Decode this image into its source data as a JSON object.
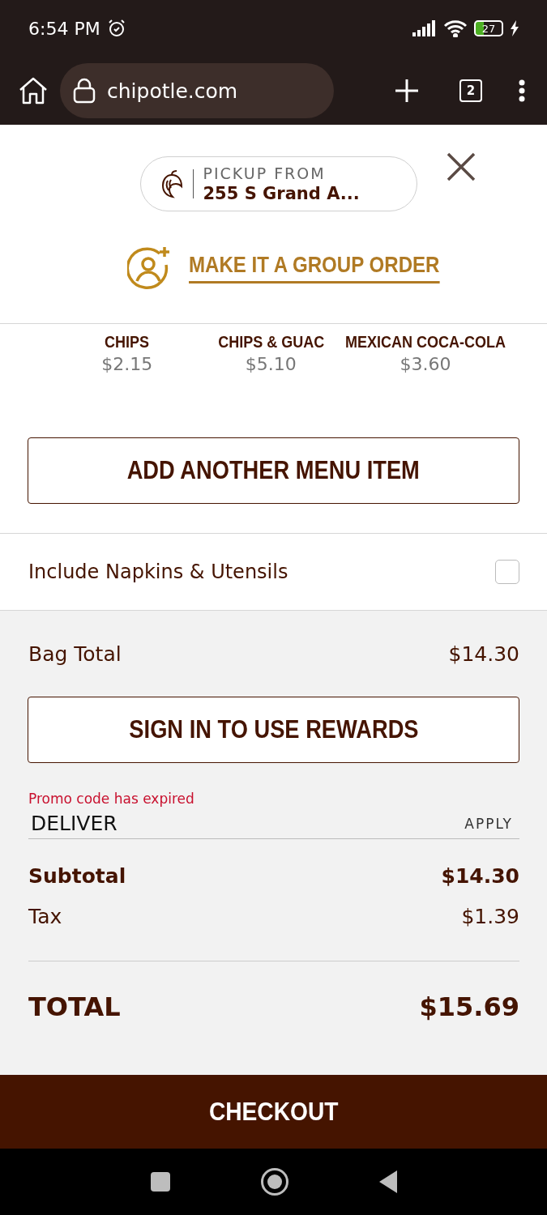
{
  "status_bar": {
    "time": "6:54 PM",
    "battery": "27"
  },
  "browser": {
    "url": "chipotle.com",
    "tab_count": "2"
  },
  "pickup": {
    "label": "PICKUP FROM",
    "address": "255 S Grand A..."
  },
  "group_order": "MAKE IT A GROUP ORDER",
  "suggestions": [
    {
      "name": "CHIPS",
      "price": "$2.15"
    },
    {
      "name": "CHIPS & GUAC",
      "price": "$5.10"
    },
    {
      "name": "MEXICAN COCA-COLA",
      "price": "$3.60"
    }
  ],
  "add_item_button": "ADD ANOTHER MENU ITEM",
  "napkins": {
    "label": "Include Napkins & Utensils",
    "checked": false
  },
  "bag_total": {
    "label": "Bag Total",
    "value": "$14.30"
  },
  "rewards_button": "SIGN IN TO USE REWARDS",
  "promo": {
    "error": "Promo code has expired",
    "value": "DELIVER",
    "apply": "APPLY"
  },
  "summary": [
    {
      "label": "Subtotal",
      "value": "$14.30",
      "kind": "bold"
    },
    {
      "label": "Tax",
      "value": "$1.39",
      "kind": "plain"
    }
  ],
  "total": {
    "label": "TOTAL",
    "value": "$15.69"
  },
  "checkout_button": "CHECKOUT"
}
